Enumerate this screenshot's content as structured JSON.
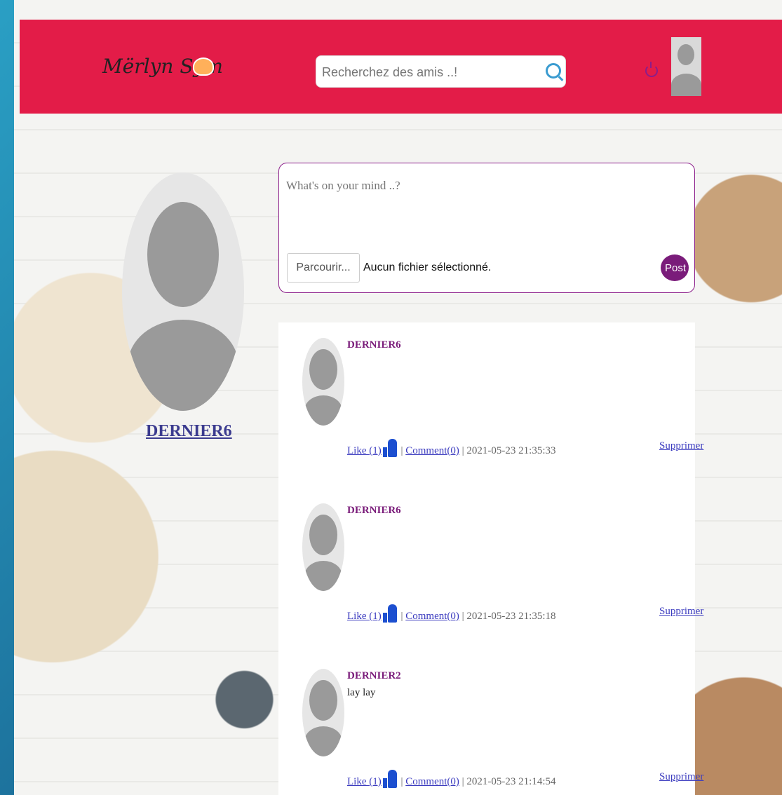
{
  "header": {
    "logo_text": "Mërlyn Sym",
    "search_placeholder": "Recherchez des amis ..!"
  },
  "icons": {
    "search": "search-icon",
    "power": "power-icon",
    "like": "thumbs-up-icon"
  },
  "profile": {
    "name": "DERNIER6"
  },
  "composer": {
    "placeholder": "What's on your mind ..?",
    "file_button_label": "Parcourir...",
    "file_status": "Aucun fichier sélectionné.",
    "post_button_label": "Post"
  },
  "posts": [
    {
      "author": "DERNIER6",
      "text": "",
      "like_label": "Like (1)",
      "comment_label": "Comment(0)",
      "separator": "|",
      "timestamp": "2021-05-23 21:35:33",
      "delete_label": "Supprimer"
    },
    {
      "author": "DERNIER6",
      "text": "",
      "like_label": "Like (1)",
      "comment_label": "Comment(0)",
      "separator": "|",
      "timestamp": "2021-05-23 21:35:18",
      "delete_label": "Supprimer"
    },
    {
      "author": "DERNIER2",
      "text": "lay lay",
      "like_label": "Like (1)",
      "comment_label": "Comment(0)",
      "separator": "|",
      "timestamp": "2021-05-23 21:14:54",
      "delete_label": "Supprimer"
    }
  ],
  "colors": {
    "header_bg": "#e31c48",
    "accent_purple": "#7a1c7a",
    "link_blue": "#3b3bbf"
  }
}
